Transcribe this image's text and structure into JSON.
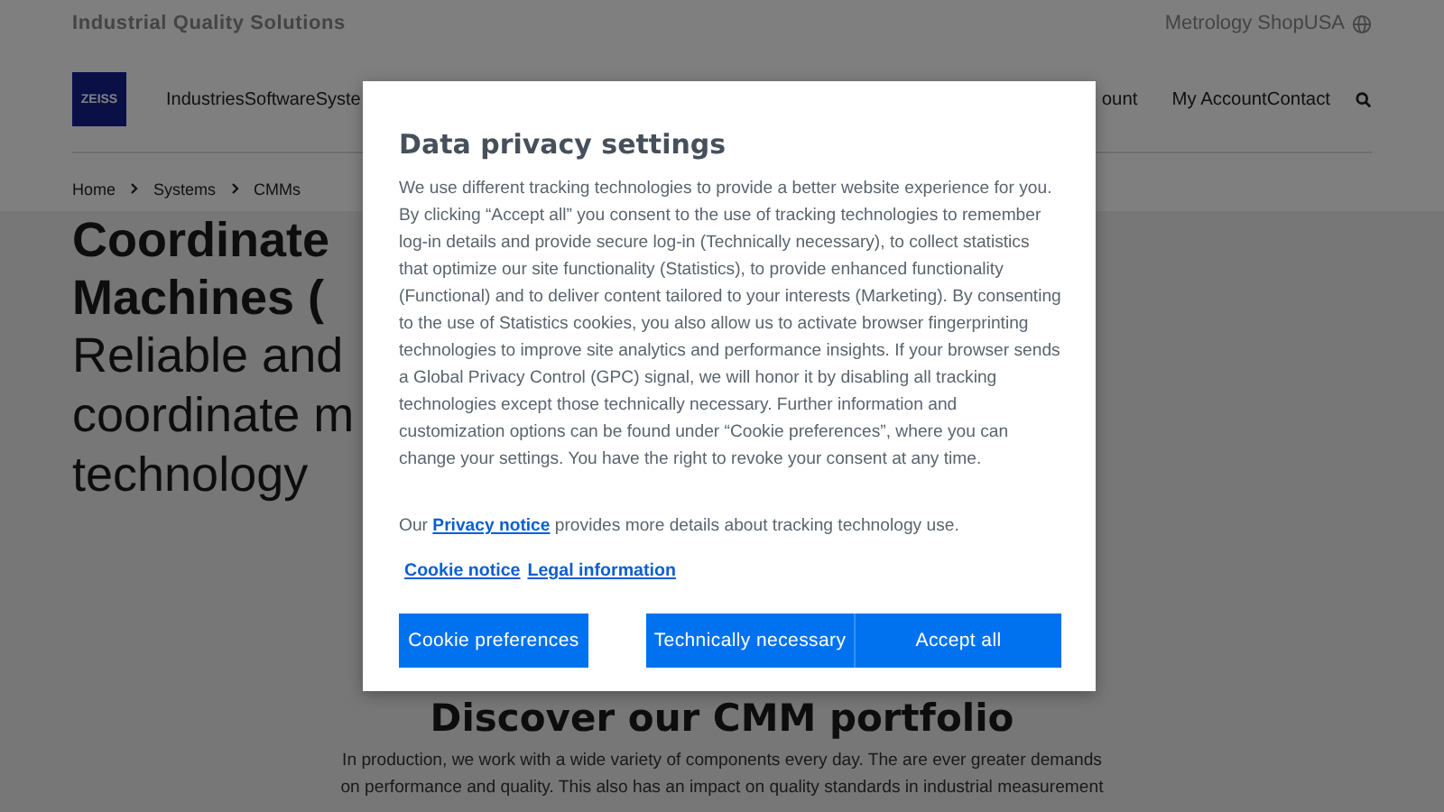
{
  "top_bar": {
    "brand_line": "Industrial Quality Solutions",
    "shop_link": "Metrology Shop",
    "region": "USA"
  },
  "header": {
    "logo": "ZEISS",
    "nav_left": [
      "Industries",
      "Software",
      "Syste"
    ],
    "nav_right": [
      "ount",
      "My Account",
      "Contact"
    ]
  },
  "breadcrumb": [
    "Home",
    "Systems",
    "CMMs"
  ],
  "hero": {
    "title_lines": [
      "Coordinate",
      "Machines ("
    ],
    "subtitle_lines": [
      "Reliable and",
      "coordinate m",
      "technology"
    ]
  },
  "section": {
    "heading": "Discover our CMM portfolio",
    "text_lines": [
      "In production, we work with a wide variety of components every day. The are ever greater demands",
      "on performance and quality. This also has an impact on quality standards in industrial measurement"
    ]
  },
  "dialog": {
    "title": "Data privacy settings",
    "body": "We use different tracking technologies to provide a better website experience for you. By clicking “Accept all” you consent to the use of tracking technologies to remember log-in details and provide secure log-in (Technically necessary), to collect statistics that optimize our site functionality (Statistics), to provide enhanced functionality (Functional) and to deliver content tailored to your interests (Marketing). By consenting to the use of Statistics cookies, you also allow us to activate browser fingerprinting technologies to improve site analytics and performance insights. If your browser sends a Global Privacy Control (GPC) signal, we will honor it by disabling all tracking technologies except those technically necessary. Further information and customization options can be found under “Cookie preferences”, where you can change your settings. You have the right to revoke your consent at any time.",
    "privacy_prefix": "Our ",
    "privacy_link": "Privacy notice",
    "privacy_suffix": " provides more details about tracking technology use.",
    "links": [
      "Cookie notice",
      "Legal information"
    ],
    "buttons": [
      {
        "label": "Cookie preferences",
        "kind": "left"
      },
      {
        "label": "Technically necessary",
        "kind": "right"
      },
      {
        "label": "Accept all",
        "kind": "right"
      }
    ]
  }
}
